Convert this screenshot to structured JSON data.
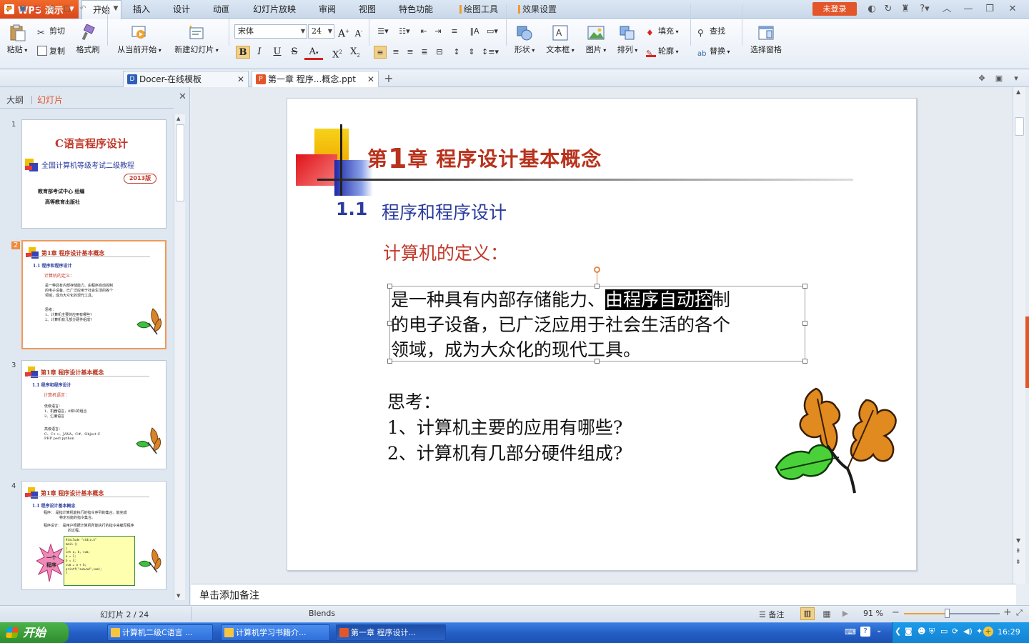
{
  "app": {
    "name": "WPS 演示",
    "login": "未登录"
  },
  "menu": [
    "开始",
    "插入",
    "设计",
    "动画",
    "幻灯片放映",
    "审阅",
    "视图",
    "特色功能",
    "绘图工具",
    "效果设置"
  ],
  "ribbon": {
    "paste": "粘贴",
    "cut": "剪切",
    "copy": "复制",
    "format_painter": "格式刷",
    "from_start": "从当前开始",
    "new_slide": "新建幻灯片",
    "font_name": "宋体",
    "font_size": "24",
    "shape": "形状",
    "textbox": "文本框",
    "picture": "图片",
    "arrange": "排列",
    "fill": "填充",
    "outline": "轮廓",
    "find": "查找",
    "replace": "替换",
    "select_pane": "选择窗格"
  },
  "tabs": [
    {
      "label": "Docer-在线模板"
    },
    {
      "label": "第一章 程序...概念.ppt"
    }
  ],
  "left_panel": {
    "tab_outline": "大纲",
    "tab_slides": "幻灯片",
    "thumbs": [
      {
        "num": "1",
        "title": "C语言程序设计",
        "subtitle": "全国计算机等级考试二级教程",
        "badge": "2013版",
        "l1": "教育部考试中心   组编",
        "l2": "高等教育出版社"
      },
      {
        "num": "2",
        "title": "第1章 程序设计基本概念",
        "sec": "1.1  程序和程序设计",
        "red": "计算机的定义：",
        "b1": "是一种具有内部存储能力、由程序自动控制",
        "b2": "的电子设备，已广泛应用于社会生活的各个",
        "b3": "领域，成为大众化的现代工具。",
        "q0": "思考：",
        "q1": "1、计算机主要的应用有哪些?",
        "q2": "2、计算机有几部分硬件组成?"
      },
      {
        "num": "3",
        "title": "第1章 程序设计基本概念",
        "sec": "1.1  程序和程序设计",
        "red": "计算机语言：",
        "b1": "低级语言：",
        "b2": "1、机器语言，0和1的组合",
        "b3": "2、汇编语言",
        "b4": "高级语言：",
        "b5": "C、C++、JAVA、C#、Object C",
        "b6": "PHP  perl  python"
      },
      {
        "num": "4",
        "title": "第1章 程序设计基本概念",
        "sec": "1.1  程序设计基本概念",
        "l1": "程序：  是指计算机能执行的指令序列的集合。能完成",
        "l2": "特定功能的指令集合。",
        "l3": "程序设计：  是用户根据计算机所能执行的指令来编写程序",
        "l4": "的过程。",
        "star1": "一个",
        "star2": "程序",
        "code": [
          "#include \"stdio.h\"",
          "main ()",
          "{",
          "  int a, b, sum;",
          "  a = 2;",
          "  b = 3;",
          "  sum = a + b;",
          "  printf(\"sum=%d\",sum);",
          "}"
        ]
      }
    ]
  },
  "slide": {
    "chapter_prefix": "第",
    "chapter_num": "1",
    "chapter_rest": "章  程序设计基本概念",
    "section_num": "1.1",
    "section_title": "程序和程序设计",
    "red_heading": "计算机的定义：",
    "body_line1_a": "是一种具有内部存储能力、",
    "body_line1_hl": "由程序自动控",
    "body_line1_b": "制",
    "body_line2": "的电子设备，已广泛应用于社会生活的各个",
    "body_line3": "领域，成为大众化的现代工具。",
    "think": "思考：",
    "q1": "1、计算机主要的应用有哪些?",
    "q2": "2、计算机有几部分硬件组成?"
  },
  "notes_placeholder": "单击添加备注",
  "status": {
    "slide_pos": "幻灯片 2 / 24",
    "theme": "Blends",
    "notes_btn": "备注",
    "zoom": "91 %"
  },
  "taskbar": {
    "start": "开始",
    "tasks": [
      "计算机二级C语言 ...",
      "计算机学习书籍介...",
      "第一章 程序设计..."
    ],
    "clock": "16:29"
  },
  "colors": {
    "accent": "#e2562a",
    "slide_title": "#b8321c",
    "slide_section": "#2b3c9e",
    "slide_red": "#c0392b"
  }
}
